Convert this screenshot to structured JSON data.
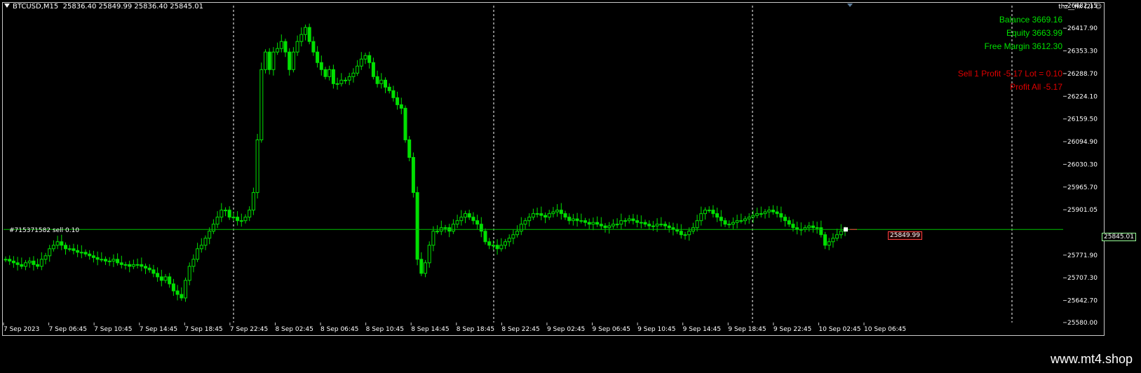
{
  "header": {
    "symbol": "BTCUSD,M15",
    "ohlc": "25836.40 25849.99 25836.40 25845.01"
  },
  "indicator_label": "thz__fix (2) ☺",
  "account": {
    "balance": "Balance 3669.16",
    "equity": "Equity 3663.99",
    "free_margin": "Free Margin 3612.30",
    "trade_line": "Sell 1   Profit -5.17  Lot = 0.10",
    "profit_all": "Profit All -5.17"
  },
  "order_label": "#715371582 sell 0.10",
  "current_price": "25845.01",
  "bid_label": "25849.99",
  "watermark": "www.mt4.shop",
  "colors": {
    "bull": "#00e000",
    "bear": "#00e000",
    "grid": "#ffffff",
    "price_line": "#00c000",
    "info_green": "#00e000",
    "info_red": "#e00000"
  },
  "chart_data": {
    "type": "line",
    "title": "BTCUSD,M15",
    "ylim": [
      25580,
      26482.15
    ],
    "yticks": [
      "26482.15",
      "26417.90",
      "26353.30",
      "26288.70",
      "26224.10",
      "26159.50",
      "26094.90",
      "26030.30",
      "25965.70",
      "25901.05",
      "25845.01",
      "25771.90",
      "25707.30",
      "25642.70",
      "25580.00"
    ],
    "xticks": [
      "7 Sep 2023",
      "7 Sep 06:45",
      "7 Sep 10:45",
      "7 Sep 14:45",
      "7 Sep 18:45",
      "7 Sep 22:45",
      "8 Sep 02:45",
      "8 Sep 06:45",
      "8 Sep 10:45",
      "8 Sep 14:45",
      "8 Sep 18:45",
      "8 Sep 22:45",
      "9 Sep 02:45",
      "9 Sep 06:45",
      "9 Sep 10:45",
      "9 Sep 14:45",
      "9 Sep 18:45",
      "9 Sep 22:45",
      "10 Sep 02:45",
      "10 Sep 06:45"
    ],
    "series": [
      {
        "values": [
          25760,
          25755,
          25750,
          25745,
          25740,
          25750,
          25755,
          25745,
          25740,
          25760,
          25770,
          25790,
          25800,
          25810,
          25800,
          25790,
          25790,
          25785,
          25780,
          25780,
          25775,
          25770,
          25765,
          25760,
          25760,
          25755,
          25755,
          25760,
          25750,
          25745,
          25745,
          25740,
          25745,
          25745,
          25740,
          25735,
          25730,
          25720,
          25710,
          25700,
          25710,
          25690,
          25670,
          25660,
          25650,
          25700,
          25740,
          25760,
          25790,
          25800,
          25820,
          25840,
          25860,
          25880,
          25900,
          25900,
          25880,
          25880,
          25870,
          25870,
          25880,
          25900,
          25950,
          26100,
          26300,
          26350,
          26300,
          26350,
          26360,
          26380,
          26350,
          26300,
          26350,
          26380,
          26400,
          26420,
          26380,
          26350,
          26320,
          26300,
          26280,
          26300,
          26260,
          26260,
          26270,
          26270,
          26280,
          26290,
          26310,
          26330,
          26340,
          26320,
          26280,
          26260,
          26270,
          26250,
          26240,
          26220,
          26200,
          26190,
          26100,
          26050,
          25950,
          25760,
          25720,
          25750,
          25800,
          25840,
          25840,
          25850,
          25850,
          25840,
          25860,
          25870,
          25880,
          25890,
          25880,
          25870,
          25860,
          25840,
          25810,
          25800,
          25800,
          25790,
          25800,
          25810,
          25820,
          25830,
          25840,
          25860,
          25870,
          25880,
          25890,
          25890,
          25885,
          25880,
          25890,
          25895,
          25900,
          25890,
          25880,
          25870,
          25875,
          25870,
          25870,
          25865,
          25860,
          25865,
          25860,
          25855,
          25850,
          25855,
          25860,
          25860,
          25870,
          25870,
          25875,
          25870,
          25865,
          25865,
          25860,
          25855,
          25855,
          25860,
          25860,
          25855,
          25850,
          25845,
          25840,
          25830,
          25830,
          25840,
          25850,
          25870,
          25890,
          25900,
          25900,
          25890,
          25880,
          25870,
          25860,
          25860,
          25865,
          25870,
          25870,
          25875,
          25880,
          25885,
          25890,
          25890,
          25895,
          25900,
          25895,
          25890,
          25880,
          25870,
          25860,
          25850,
          25845,
          25845,
          25850,
          25855,
          25850,
          25850,
          25830,
          25800,
          25810,
          25820,
          25830,
          25840,
          25845
        ]
      }
    ]
  }
}
